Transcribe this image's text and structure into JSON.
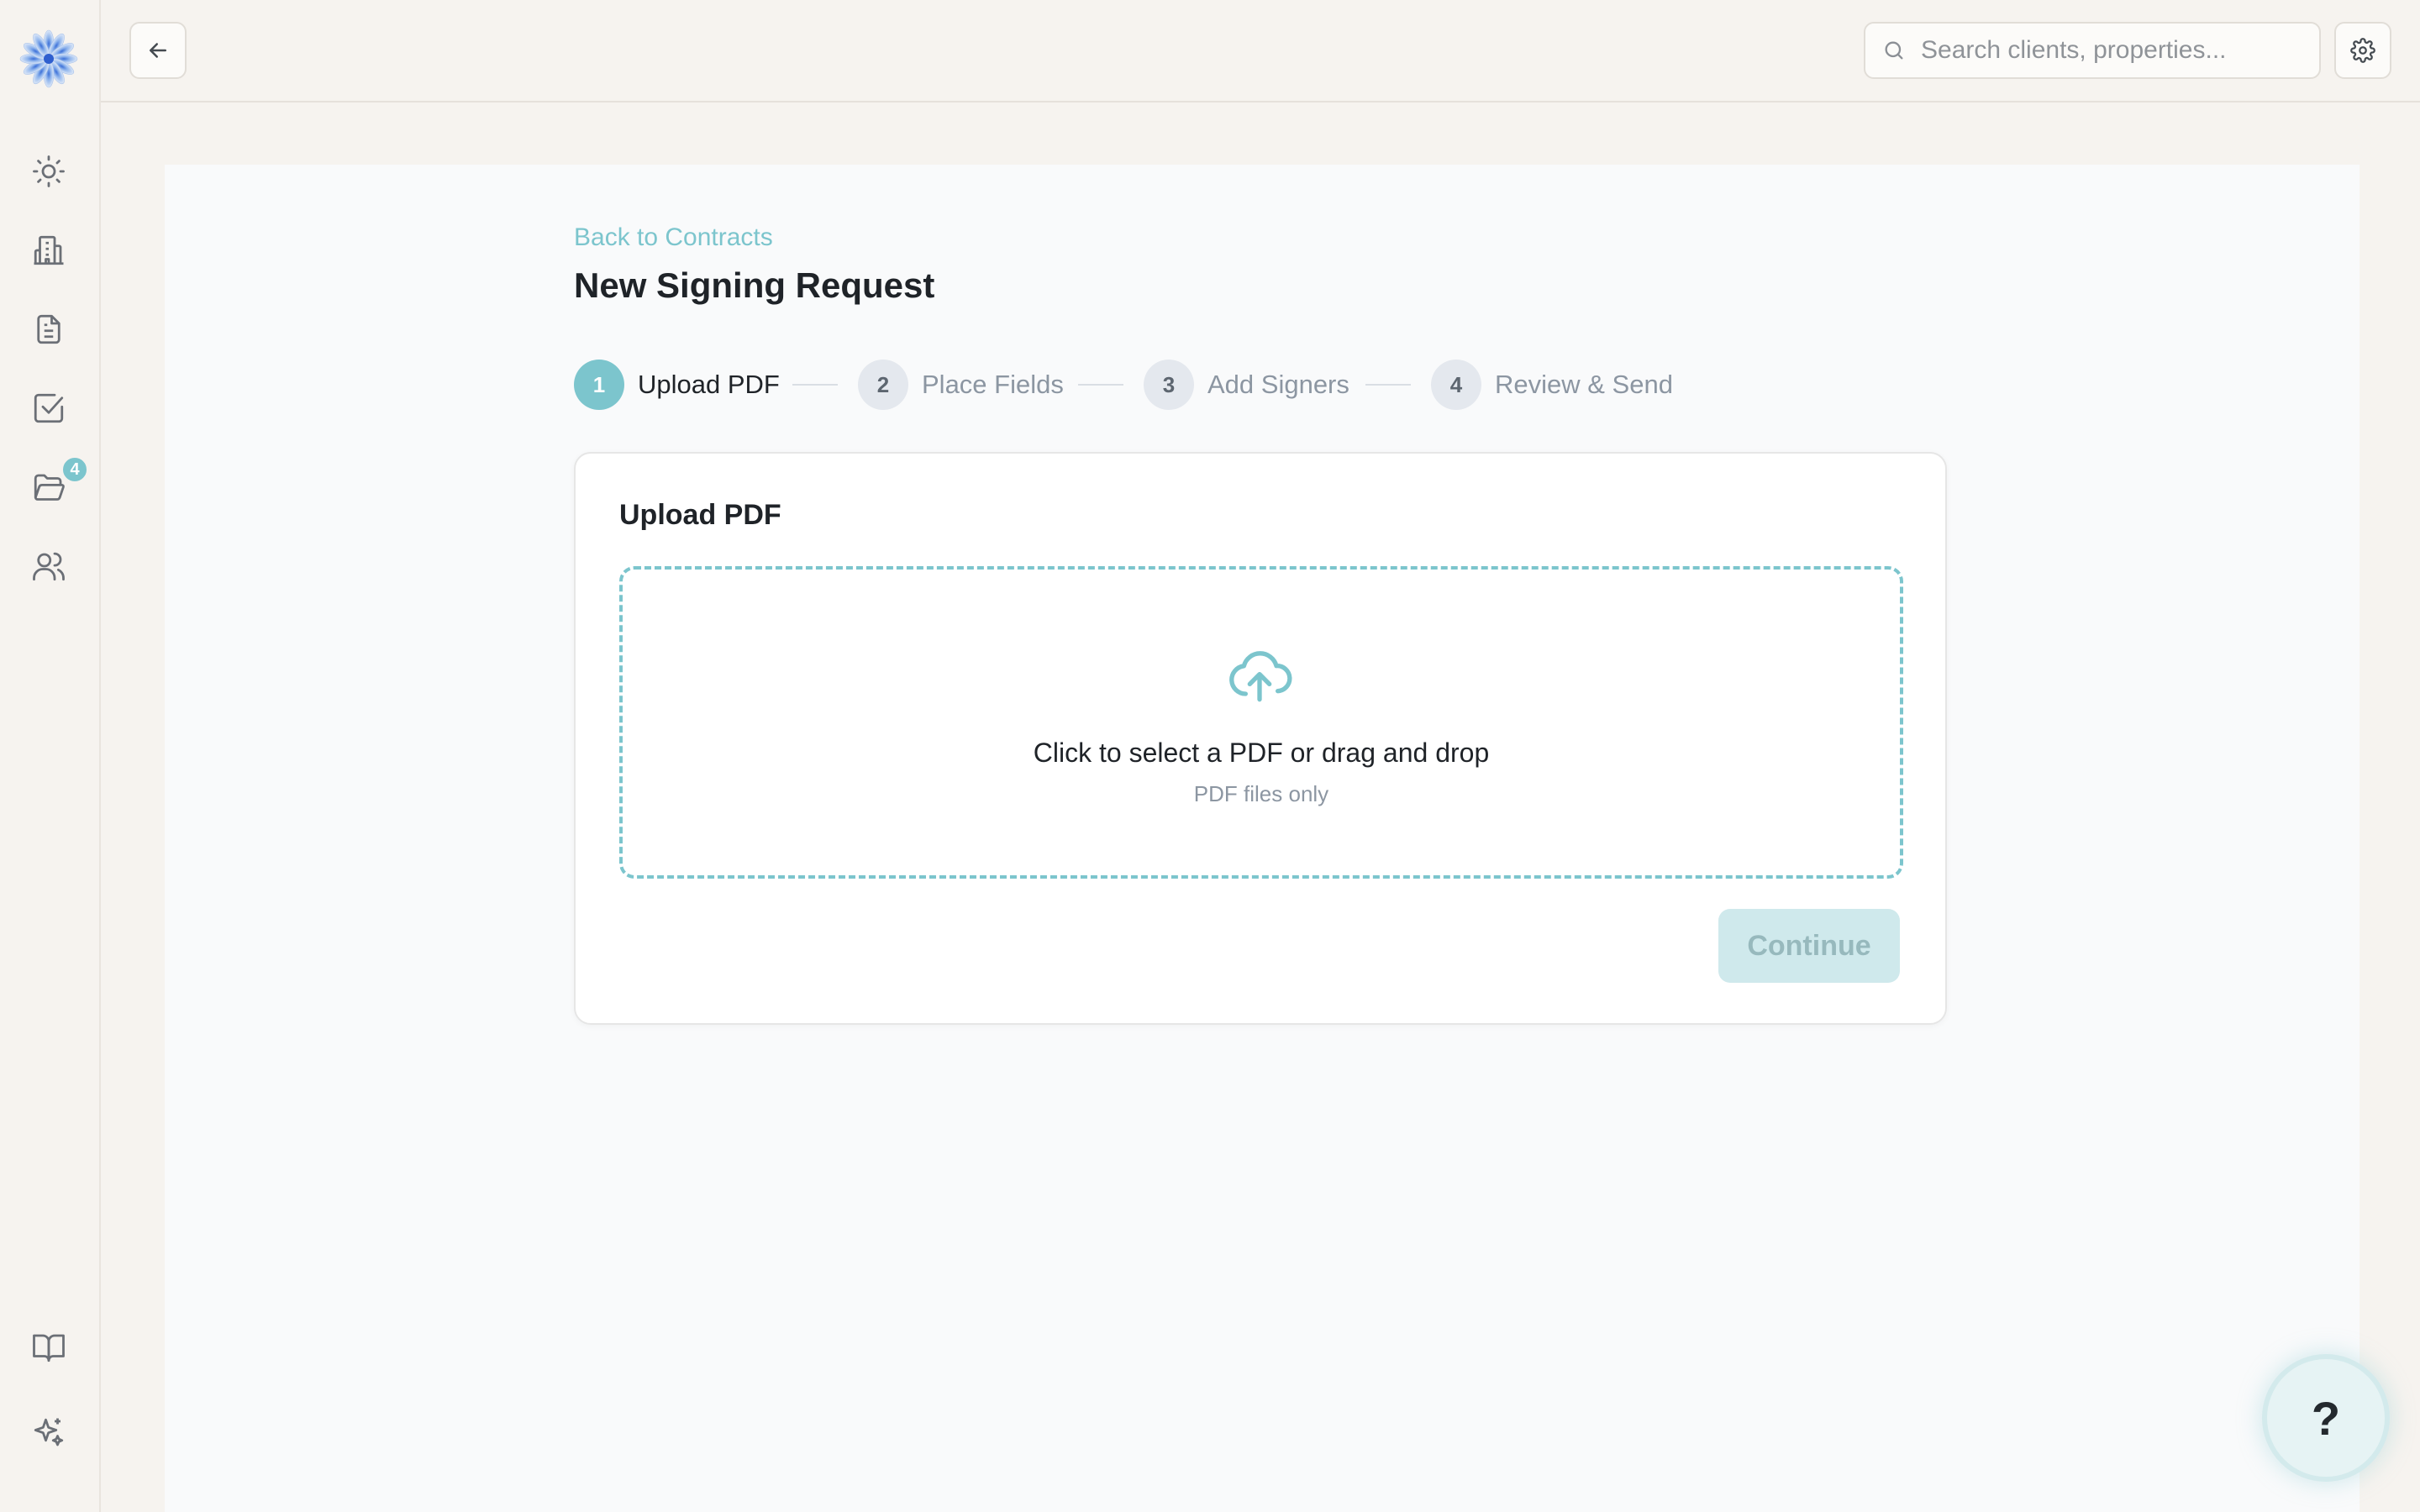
{
  "sidebar": {
    "items": [
      {
        "name": "dashboard",
        "icon": "sun-icon"
      },
      {
        "name": "properties",
        "icon": "building-icon"
      },
      {
        "name": "contracts",
        "icon": "document-icon"
      },
      {
        "name": "tasks",
        "icon": "checkbox-icon"
      },
      {
        "name": "files",
        "icon": "folder-open-icon",
        "badge": "4"
      },
      {
        "name": "clients",
        "icon": "users-icon"
      }
    ],
    "bottom_items": [
      {
        "name": "guide",
        "icon": "book-open-icon"
      },
      {
        "name": "ai-assistant",
        "icon": "sparkles-icon"
      }
    ]
  },
  "topbar": {
    "search": {
      "placeholder": "Search clients, properties..."
    }
  },
  "page": {
    "back_link": "Back to Contracts",
    "title": "New Signing Request"
  },
  "stepper": {
    "steps": [
      {
        "number": "1",
        "label": "Upload PDF",
        "active": true
      },
      {
        "number": "2",
        "label": "Place Fields",
        "active": false
      },
      {
        "number": "3",
        "label": "Add Signers",
        "active": false
      },
      {
        "number": "4",
        "label": "Review & Send",
        "active": false
      }
    ]
  },
  "card": {
    "title": "Upload PDF",
    "dropzone": {
      "text": "Click to select a PDF or drag and drop",
      "subtext": "PDF files only"
    },
    "continue_label": "Continue"
  },
  "help": {
    "label": "?"
  },
  "colors": {
    "accent": "#7cc5cd",
    "accent_disabled_bg": "#cfe9ec",
    "background": "#f6f3ef",
    "panel": "#f9fafb"
  }
}
